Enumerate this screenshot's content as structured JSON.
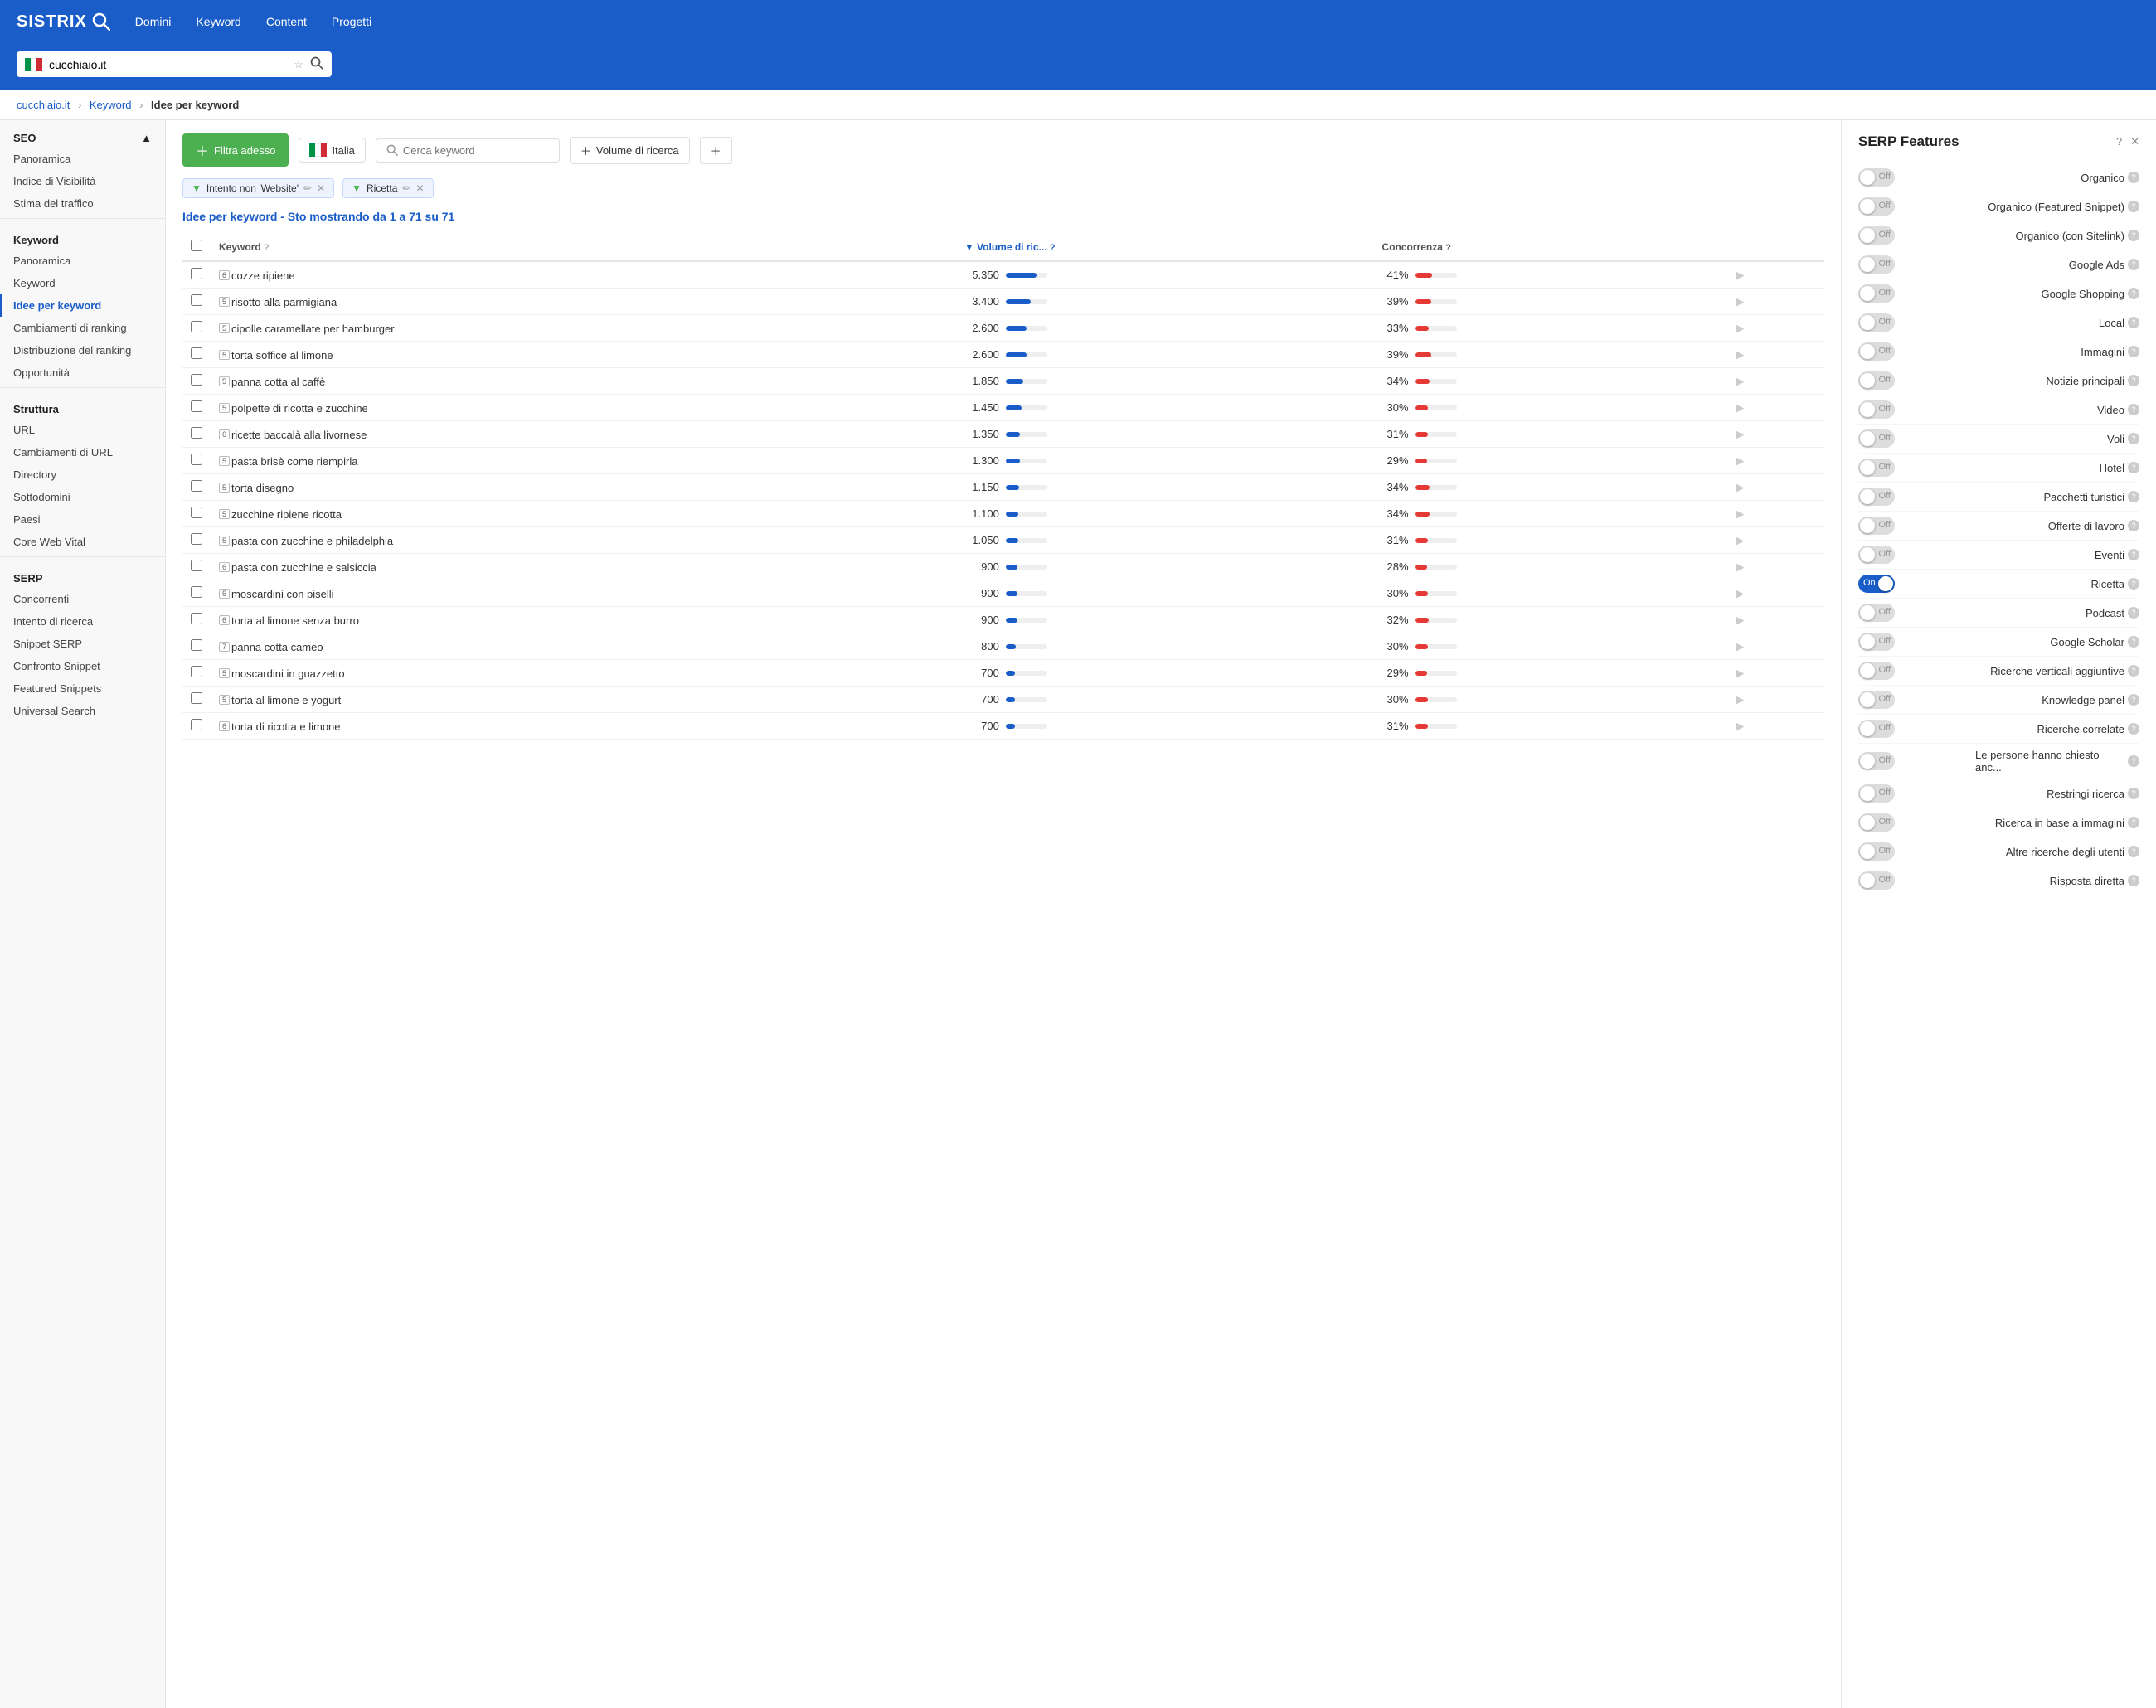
{
  "nav": {
    "logo_text": "SISTRIX",
    "links": [
      "Domini",
      "Keyword",
      "Content",
      "Progetti"
    ]
  },
  "search": {
    "domain": "cucchiaio.it",
    "placeholder": "cucchiaio.it"
  },
  "breadcrumb": {
    "items": [
      "cucchiaio.it",
      "Keyword"
    ],
    "current": "Idee per keyword"
  },
  "filters": {
    "add_button": "Filtra adesso",
    "country": "Italia",
    "search_placeholder": "Cerca keyword",
    "volume_label": "Volume di ricerca"
  },
  "active_filters": [
    {
      "label": "Intento non 'Website'"
    },
    {
      "label": "Ricetta"
    }
  ],
  "results_title": "Idee per keyword - Sto mostrando da 1 a 71 su 71",
  "table": {
    "headers": [
      "Keyword",
      "Volume di ric...",
      "Concorrenza"
    ],
    "rows": [
      {
        "kw": "cozze ripiene",
        "score": 6,
        "volume": 5350,
        "vol_pct": 75,
        "comp": 41,
        "comp_pct": 41
      },
      {
        "kw": "risotto alla parmigiana",
        "score": 5,
        "volume": 3400,
        "vol_pct": 60,
        "comp": 39,
        "comp_pct": 39
      },
      {
        "kw": "cipolle caramellate per hamburger",
        "score": 5,
        "volume": 2600,
        "vol_pct": 50,
        "comp": 33,
        "comp_pct": 33
      },
      {
        "kw": "torta soffice al limone",
        "score": 5,
        "volume": 2600,
        "vol_pct": 50,
        "comp": 39,
        "comp_pct": 39
      },
      {
        "kw": "panna cotta al caffè",
        "score": 5,
        "volume": 1850,
        "vol_pct": 42,
        "comp": 34,
        "comp_pct": 34
      },
      {
        "kw": "polpette di ricotta e zucchine",
        "score": 5,
        "volume": 1450,
        "vol_pct": 38,
        "comp": 30,
        "comp_pct": 30
      },
      {
        "kw": "ricette baccalà alla livornese",
        "score": 6,
        "volume": 1350,
        "vol_pct": 35,
        "comp": 31,
        "comp_pct": 31
      },
      {
        "kw": "pasta brisè come riempirla",
        "score": 5,
        "volume": 1300,
        "vol_pct": 34,
        "comp": 29,
        "comp_pct": 29
      },
      {
        "kw": "torta disegno",
        "score": 5,
        "volume": 1150,
        "vol_pct": 32,
        "comp": 34,
        "comp_pct": 34
      },
      {
        "kw": "zucchine ripiene ricotta",
        "score": 5,
        "volume": 1100,
        "vol_pct": 31,
        "comp": 34,
        "comp_pct": 34
      },
      {
        "kw": "pasta con zucchine e philadelphia",
        "score": 5,
        "volume": 1050,
        "vol_pct": 30,
        "comp": 31,
        "comp_pct": 31
      },
      {
        "kw": "pasta con zucchine e salsiccia",
        "score": 6,
        "volume": 900,
        "vol_pct": 28,
        "comp": 28,
        "comp_pct": 28
      },
      {
        "kw": "moscardini con piselli",
        "score": 5,
        "volume": 900,
        "vol_pct": 28,
        "comp": 30,
        "comp_pct": 30
      },
      {
        "kw": "torta al limone senza burro",
        "score": 6,
        "volume": 900,
        "vol_pct": 28,
        "comp": 32,
        "comp_pct": 32
      },
      {
        "kw": "panna cotta cameo",
        "score": 7,
        "volume": 800,
        "vol_pct": 25,
        "comp": 30,
        "comp_pct": 30
      },
      {
        "kw": "moscardini in guazzetto",
        "score": 5,
        "volume": 700,
        "vol_pct": 22,
        "comp": 29,
        "comp_pct": 29
      },
      {
        "kw": "torta al limone e yogurt",
        "score": 5,
        "volume": 700,
        "vol_pct": 22,
        "comp": 30,
        "comp_pct": 30
      },
      {
        "kw": "torta di ricotta e limone",
        "score": 6,
        "volume": 700,
        "vol_pct": 22,
        "comp": 31,
        "comp_pct": 31
      }
    ]
  },
  "serp_panel": {
    "title": "SERP Features",
    "features": [
      {
        "name": "Organico",
        "state": "off"
      },
      {
        "name": "Organico (Featured Snippet)",
        "state": "off"
      },
      {
        "name": "Organico (con Sitelink)",
        "state": "off"
      },
      {
        "name": "Google Ads",
        "state": "off"
      },
      {
        "name": "Google Shopping",
        "state": "off"
      },
      {
        "name": "Local",
        "state": "off"
      },
      {
        "name": "Immagini",
        "state": "off"
      },
      {
        "name": "Notizie principali",
        "state": "off"
      },
      {
        "name": "Video",
        "state": "off"
      },
      {
        "name": "Voli",
        "state": "off"
      },
      {
        "name": "Hotel",
        "state": "off"
      },
      {
        "name": "Pacchetti turistici",
        "state": "off"
      },
      {
        "name": "Offerte di lavoro",
        "state": "off"
      },
      {
        "name": "Eventi",
        "state": "off"
      },
      {
        "name": "Ricetta",
        "state": "on"
      },
      {
        "name": "Podcast",
        "state": "off"
      },
      {
        "name": "Google Scholar",
        "state": "off"
      },
      {
        "name": "Ricerche verticali aggiuntive",
        "state": "off"
      },
      {
        "name": "Knowledge panel",
        "state": "off"
      },
      {
        "name": "Ricerche correlate",
        "state": "off"
      },
      {
        "name": "Le persone hanno chiesto anc...",
        "state": "off"
      },
      {
        "name": "Restringi ricerca",
        "state": "off"
      },
      {
        "name": "Ricerca in base a immagini",
        "state": "off"
      },
      {
        "name": "Altre ricerche degli utenti",
        "state": "off"
      },
      {
        "name": "Risposta diretta",
        "state": "off"
      }
    ]
  },
  "sidebar": {
    "sections": [
      {
        "title": "SEO",
        "items": [
          "Panoramica",
          "Indice di Visibilità",
          "Stima del traffico"
        ]
      },
      {
        "title": "Keyword",
        "items": [
          "Panoramica",
          "Keyword",
          "Idee per keyword",
          "Cambiamenti di ranking",
          "Distribuzione del ranking",
          "Opportunità"
        ]
      },
      {
        "title": "Struttura",
        "items": [
          "URL",
          "Cambiamenti di URL",
          "Directory",
          "Sottodomini",
          "Paesi",
          "Core Web Vital"
        ]
      },
      {
        "title": "SERP",
        "items": [
          "Concorrenti",
          "Intento di ricerca",
          "Snippet SERP",
          "Confronto Snippet",
          "Featured Snippets",
          "Universal Search"
        ]
      }
    ]
  }
}
